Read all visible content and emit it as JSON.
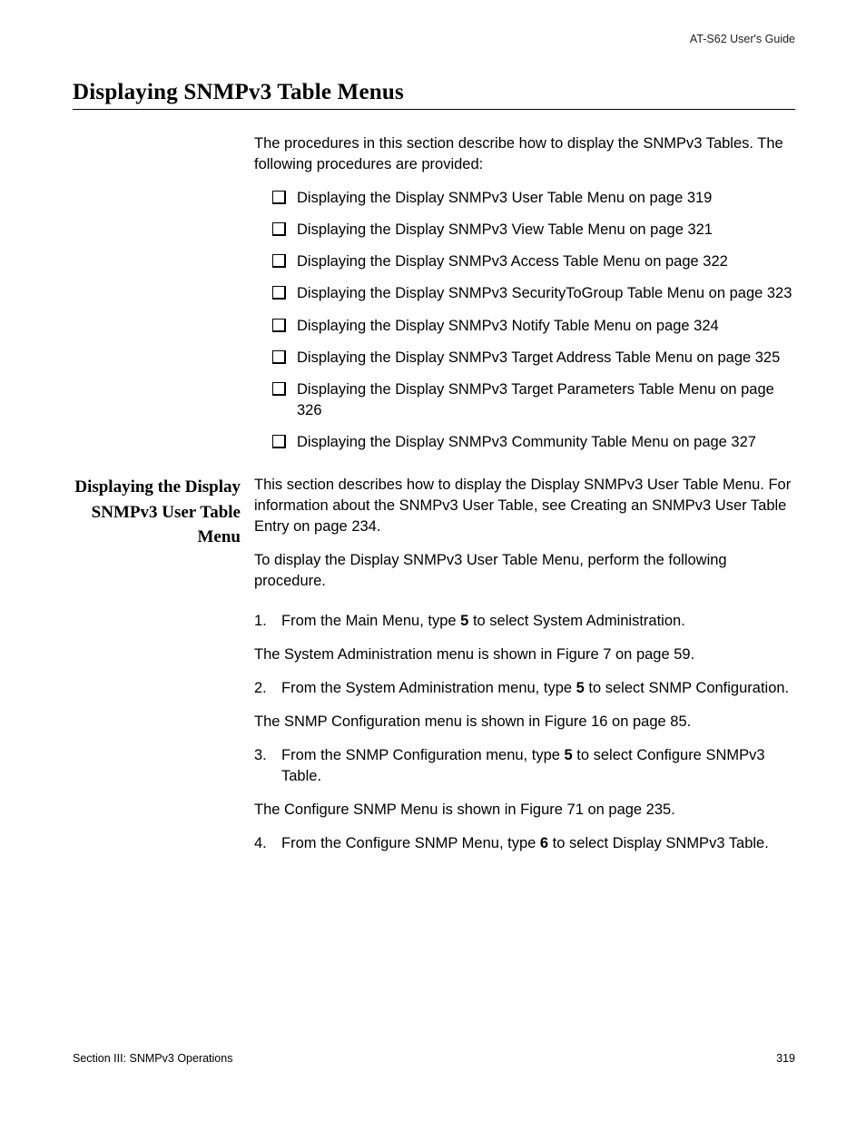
{
  "running_head": "AT-S62 User's Guide",
  "title": "Displaying SNMPv3 Table Menus",
  "intro": "The procedures in this section describe how to display the SNMPv3 Tables. The following procedures are provided:",
  "bullets": {
    "b0": "Displaying the Display SNMPv3 User Table Menu on page 319",
    "b1": "Displaying the Display SNMPv3 View Table Menu on page 321",
    "b2": "Displaying the Display SNMPv3 Access Table Menu on page 322",
    "b3": "Displaying the Display SNMPv3 SecurityToGroup Table Menu on page 323",
    "b4": "Displaying the Display SNMPv3 Notify Table Menu on page 324",
    "b5": "Displaying the Display SNMPv3 Target Address Table Menu on page 325",
    "b6": "Displaying the Display SNMPv3 Target Parameters Table Menu on page 326",
    "b7": "Displaying the Display SNMPv3 Community Table Menu on page 327"
  },
  "side_heading": "Displaying the Display SNMPv3 User Table Menu",
  "sec_p1": "This section describes how to display the Display SNMPv3 User Table Menu. For information about the SNMPv3 User Table, see Creating an SNMPv3 User Table Entry on page 234.",
  "sec_p2": "To display the Display SNMPv3 User Table Menu, perform the following procedure.",
  "steps": {
    "s1_a": "From the Main Menu, type ",
    "s1_num": "5",
    "s1_b": " to select System Administration.",
    "n1": "The System Administration menu is shown in Figure 7  on page 59.",
    "s2_a": "From the System Administration menu, type ",
    "s2_num": "5",
    "s2_b": " to select SNMP Configuration.",
    "n2": "The SNMP Configuration menu is shown in Figure 16  on page 85.",
    "s3_a": "From the SNMP Configuration menu, type ",
    "s3_num": "5",
    "s3_b": " to select Configure SNMPv3 Table.",
    "n3": "The Configure SNMP Menu is shown in Figure 71 on page 235.",
    "s4_a": "From the Configure SNMP Menu, type ",
    "s4_num": "6",
    "s4_b": " to select Display SNMPv3 Table."
  },
  "footer_left": "Section III: SNMPv3 Operations",
  "footer_right": "319"
}
